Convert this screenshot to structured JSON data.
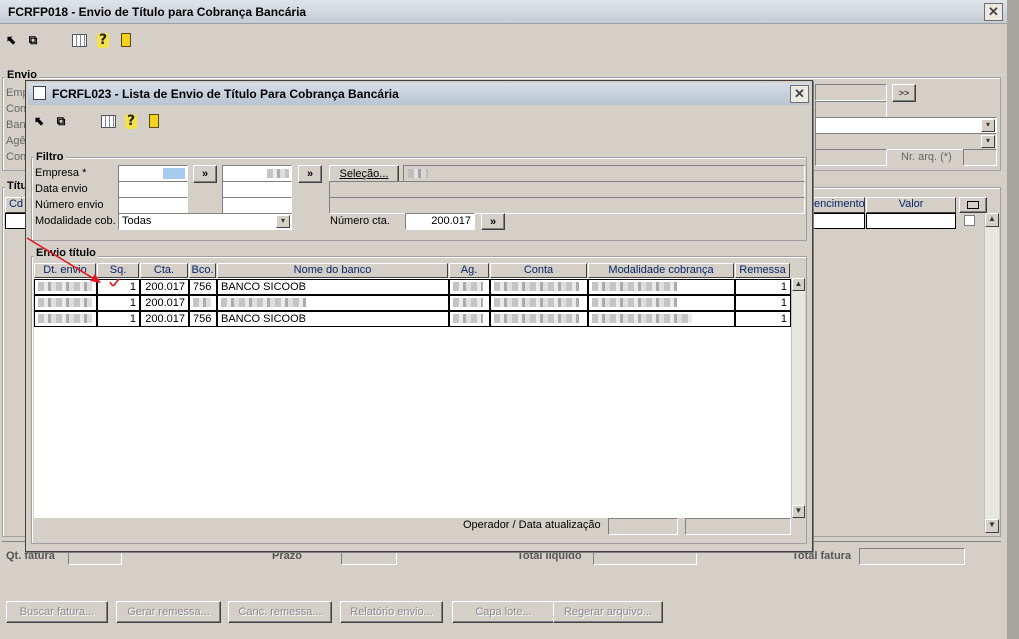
{
  "main_window": {
    "title": "FCRFP018 - Envio de Título para Cobrança Bancária",
    "close_symbol": "✕",
    "toolbar_icons": [
      "first-icon",
      "previous-icon",
      "calendar-icon",
      "help-icon",
      "exit-icon"
    ],
    "envio_group": "Envio",
    "partial_labels": [
      "Emp",
      "Con",
      "Ban",
      "Agê",
      "Con"
    ],
    "titulos_group": "Títu",
    "grid_left_header": "Cd",
    "grid_headers_right": [
      "encimento",
      "Valor"
    ],
    "nr_arq_label": "Nr. arq. (*)",
    "footer": {
      "qt_fatura": "Qt. fatura",
      "prazo": "Prazo",
      "total_liquido": "Total líquido",
      "total_fatura": "Total fatura"
    },
    "bottom_buttons": [
      "Buscar fatura...",
      "Gerar remessa...",
      "Canc. remessa...",
      "Relatório envio...",
      "Capa lote...",
      "Regerar arquivo..."
    ],
    "bottom_button_hotkeys": [
      "B",
      "G",
      "C",
      "R",
      "l",
      "R"
    ]
  },
  "dialog": {
    "title": "FCRFL023 - Lista de Envio de Título Para Cobrança Bancária",
    "close_symbol": "✕",
    "filtro": {
      "group_label": "Filtro",
      "empresa_label": "Empresa *",
      "data_envio_label": "Data envio",
      "numero_envio_label": "Número envio",
      "modalidade_label": "Modalidade cob.",
      "modalidade_value": "Todas",
      "selecao_button": "Seleção...",
      "numero_cta_label": "Número cta.",
      "numero_cta_value": "200.017",
      "range_button": "»"
    },
    "envio_titulo": {
      "group_label": "Envio título",
      "columns": [
        "Dt. envio",
        "Sq.",
        "Cta.",
        "Bco.",
        "Nome do banco",
        "Ag.",
        "Conta",
        "Modalidade cobrança",
        "Remessa"
      ],
      "rows": [
        {
          "dt_envio": "",
          "sq": "1",
          "cta": "200.017",
          "bco": "756",
          "nome_banco": "BANCO SICOOB",
          "ag": "",
          "conta": "",
          "modalidade": "",
          "remessa": "1"
        },
        {
          "dt_envio": "",
          "sq": "1",
          "cta": "200.017",
          "bco": "",
          "nome_banco": "",
          "ag": "",
          "conta": "",
          "modalidade": "",
          "remessa": "1"
        },
        {
          "dt_envio": "",
          "sq": "1",
          "cta": "200.017",
          "bco": "756",
          "nome_banco": "BANCO SICOOB",
          "ag": "",
          "conta": "",
          "modalidade": "",
          "remessa": "1"
        }
      ]
    },
    "operador_label": "Operador / Data atualização"
  },
  "colors": {
    "face": "#d4d0c8",
    "title_bar": "#c7ccd3",
    "header_text": "#0a246a",
    "annotation_red": "#e8141c",
    "selection_blue": "#a6caf0"
  }
}
